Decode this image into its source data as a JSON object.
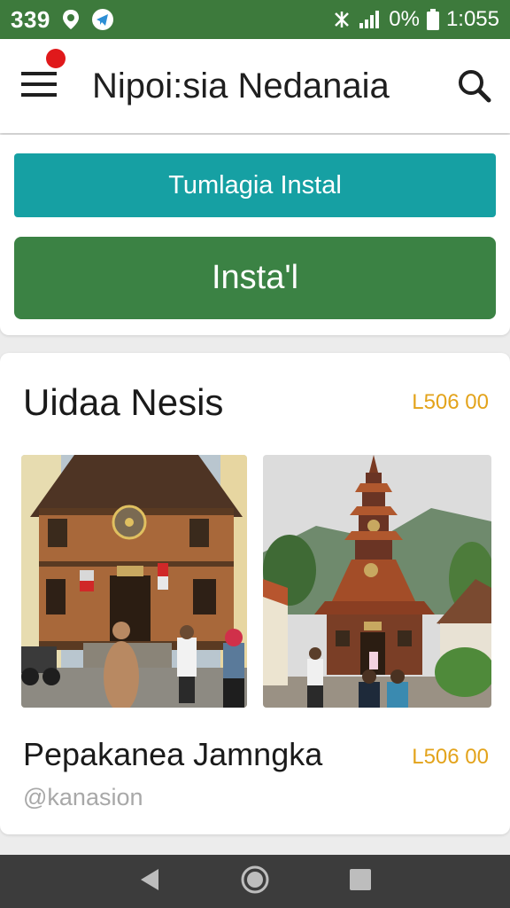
{
  "status_bar": {
    "time_left": "339",
    "battery_percent": "0%",
    "clock": "1:055",
    "icons": [
      "location-pin-icon",
      "telegram-icon",
      "vibrate-icon",
      "signal-icon",
      "battery-icon"
    ]
  },
  "app_bar": {
    "title": "Nipoi:sia Nedanaia",
    "menu_icon": "hamburger-menu-icon",
    "notification_badge": "red-dot",
    "search_icon": "search-icon"
  },
  "install_card": {
    "secondary_button_label": "Tumlagia Instal",
    "primary_button_label": "Insta'l"
  },
  "content_card": {
    "section_title": "Uidaa Nesis",
    "section_price": "L506 00",
    "photos": [
      "wooden-heritage-house-photo",
      "pagoda-tower-photo"
    ],
    "item_title": "Pepakanea Jamngka",
    "item_price": "L506 00",
    "item_handle": "@kanasion"
  },
  "nav_bar": {
    "icons": [
      "back-icon",
      "home-icon",
      "recents-icon"
    ]
  },
  "colors": {
    "status_bar": "#3d7a3c",
    "secondary_button": "#16a0a3",
    "primary_button": "#3b8244",
    "price": "#e3a31b",
    "badge": "#e0191b"
  }
}
